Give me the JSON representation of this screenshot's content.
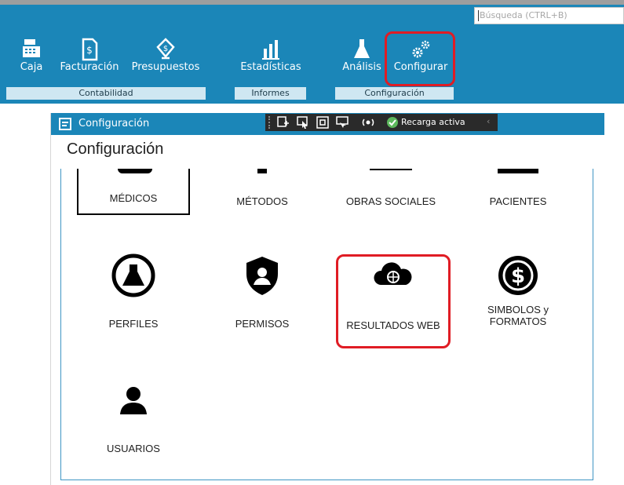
{
  "search": {
    "placeholder": "Búsqueda (CTRL+B)"
  },
  "ribbon": {
    "buttons": [
      {
        "label": "Caja",
        "icon": "cash-register-icon"
      },
      {
        "label": "Facturación",
        "icon": "invoice-icon"
      },
      {
        "label": "Presupuestos",
        "icon": "price-tag-icon"
      },
      {
        "label": "Estadísticas",
        "icon": "bar-chart-icon"
      },
      {
        "label": "Análisis",
        "icon": "flask-icon"
      },
      {
        "label": "Configurar",
        "icon": "gears-icon"
      }
    ],
    "groups": [
      "Contabilidad",
      "Informes",
      "Configuración"
    ]
  },
  "window": {
    "title": "Configuración",
    "heading": "Configuración"
  },
  "devtools": {
    "status": "Recarga activa"
  },
  "tiles": [
    {
      "label": "MÉDICOS",
      "icon": "doctors-icon"
    },
    {
      "label": "MÉTODOS",
      "icon": "methods-icon"
    },
    {
      "label": "OBRAS SOCIALES",
      "icon": "health-insurance-icon"
    },
    {
      "label": "PACIENTES",
      "icon": "patients-icon"
    },
    {
      "label": "PERFILES",
      "icon": "flask-circle-icon"
    },
    {
      "label": "PERMISOS",
      "icon": "shield-user-icon"
    },
    {
      "label": "RESULTADOS WEB",
      "icon": "cloud-globe-icon"
    },
    {
      "label_line1": "SIMBOLOS y",
      "label_line2": "FORMATOS",
      "icon": "dollar-circle-icon"
    },
    {
      "label": "USUARIOS",
      "icon": "user-icon"
    }
  ],
  "colors": {
    "ribbon": "#1b86b8",
    "highlight": "#e01c24"
  }
}
